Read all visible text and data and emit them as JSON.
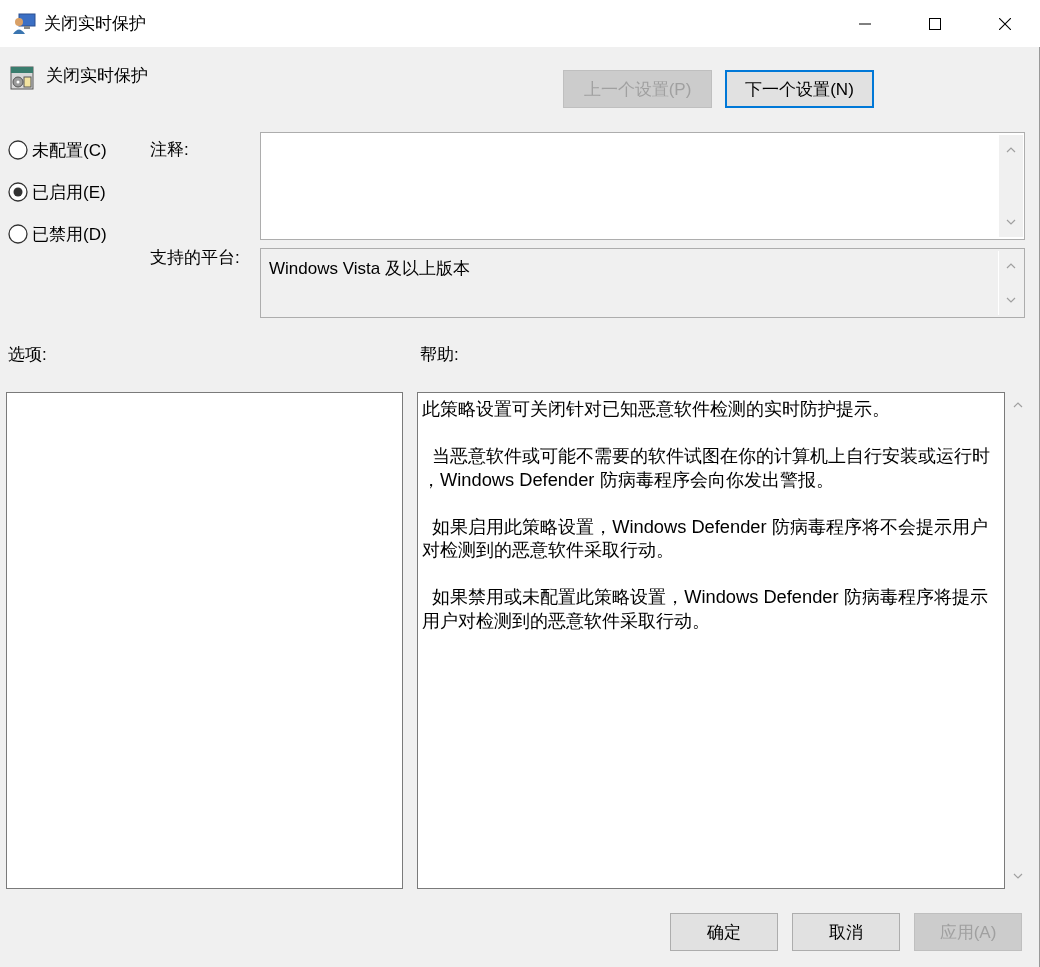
{
  "window": {
    "title": "关闭实时保护"
  },
  "header": {
    "title": "关闭实时保护"
  },
  "nav_buttons": [
    {
      "label": "上一个设置(P)",
      "disabled": true,
      "focused": false
    },
    {
      "label": "下一个设置(N)",
      "disabled": false,
      "focused": true
    }
  ],
  "options": [
    {
      "label": "未配置(C)",
      "selected": false
    },
    {
      "label": "已启用(E)",
      "selected": true
    },
    {
      "label": "已禁用(D)",
      "selected": false
    }
  ],
  "comment": {
    "label": "注释:"
  },
  "platform": {
    "label": "支持的平台:",
    "value": "Windows Vista 及以上版本"
  },
  "options_panel": {
    "label": "选项:"
  },
  "help": {
    "label": "帮助:",
    "paragraphs": [
      "此策略设置可关闭针对已知恶意软件检测的实时防护提示。",
      "  当恶意软件或可能不需要的软件试图在你的计算机上自行安装或运行时，Windows Defender 防病毒程序会向你发出警报。",
      "  如果启用此策略设置，Windows Defender 防病毒程序将不会提示用户对检测到的恶意软件采取行动。",
      "  如果禁用或未配置此策略设置，Windows Defender 防病毒程序将提示用户对检测到的恶意软件采取行动。"
    ]
  },
  "footer_buttons": [
    {
      "label": "确定",
      "disabled": false
    },
    {
      "label": "取消",
      "disabled": false
    },
    {
      "label": "应用(A)",
      "disabled": true
    }
  ]
}
